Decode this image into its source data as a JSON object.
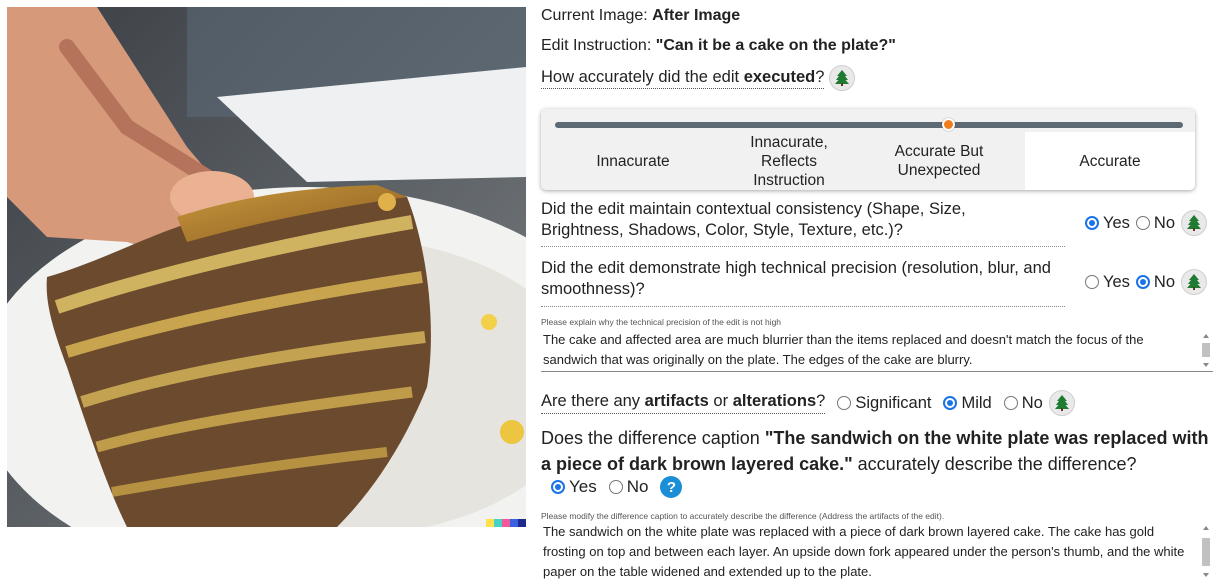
{
  "image_panel": {
    "color_strip": [
      "#ffe14d",
      "#45d3c8",
      "#f05a9a",
      "#3a5fe0",
      "#1b2a8c"
    ]
  },
  "header": {
    "current_image_label": "Current Image:",
    "current_image_value": "After Image",
    "edit_instruction_label": "Edit Instruction:",
    "edit_instruction_value": "\"Can it be a cake on the plate?\""
  },
  "q_executed": {
    "text_before": "How accurately did the edit ",
    "text_bold": "executed",
    "text_after": "?",
    "options": [
      "Innacurate",
      "Innacurate, Reflects Instruction",
      "Accurate But Unexpected",
      "Accurate"
    ],
    "selected_index": 3,
    "slider_fraction": 0.627
  },
  "q_consistency": {
    "text": "Did the edit maintain contextual consistency (Shape, Size, Brightness, Shadows, Color, Style, Texture, etc.)?",
    "yes_label": "Yes",
    "no_label": "No",
    "selected": "Yes"
  },
  "q_precision": {
    "text": "Did the edit demonstrate high technical precision (resolution, blur, and smoothness)?",
    "yes_label": "Yes",
    "no_label": "No",
    "selected": "No",
    "explain_label": "Please explain why the technical precision of the edit is not high",
    "explain_text": "The cake and affected area are much blurrier than the items replaced and doesn't match the focus of the sandwich that was originally on the plate. The edges of the cake are blurry."
  },
  "q_artifacts": {
    "text_1": "Are there any ",
    "bold_1": "artifacts",
    "text_2": " or ",
    "bold_2": "alterations",
    "text_3": "?",
    "options": [
      "Significant",
      "Mild",
      "No"
    ],
    "selected": "Mild"
  },
  "q_caption": {
    "text_1": "Does the difference caption ",
    "bold_caption": "\"The sandwich on the white plate was replaced with a piece of dark brown layered cake.\"",
    "text_2": " accurately describe the difference?",
    "yes_label": "Yes",
    "no_label": "No",
    "selected": "Yes",
    "help_icon_text": "?",
    "modify_label": "Please modify the difference caption to accurately describe the difference (Address the artifacts of the edit).",
    "modify_text": "The sandwich on the white plate was replaced with a piece of dark brown layered cake. The cake has gold frosting on top and between each layer. An upside down fork appeared under the person's thumb, and the white paper on the table widened and extended up to the plate."
  },
  "icons": {
    "tree": "tree-icon",
    "help": "question-icon"
  },
  "colors": {
    "accent": "#1a73e8",
    "slider_thumb": "#f07d1b",
    "help": "#1a8fd6",
    "tree": "#1f7a32"
  }
}
